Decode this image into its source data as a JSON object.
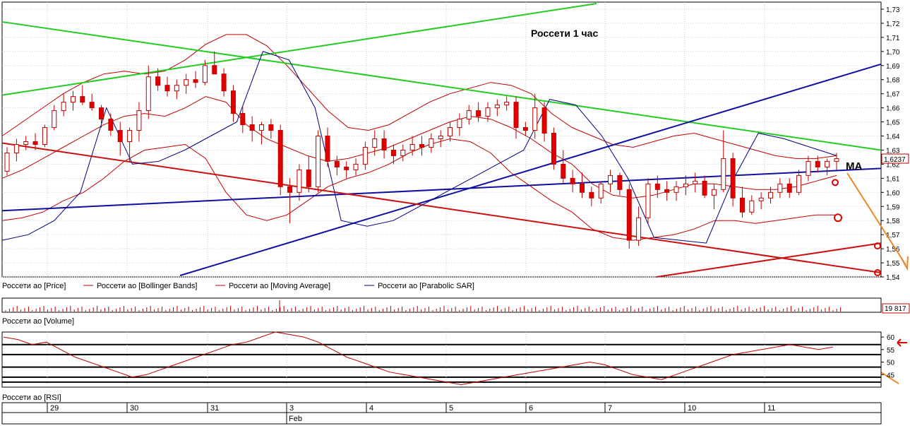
{
  "chart_data": [
    {
      "type": "candlestick",
      "title": "Россети   1 час",
      "annotation": "MA",
      "ylim": [
        1.54,
        1.735
      ],
      "y_ticks": [
        "1,73",
        "1,72",
        "1,71",
        "1,70",
        "1,69",
        "1,68",
        "1,67",
        "1,66",
        "1,65",
        "1,64",
        "1,63",
        "1,62",
        "1,61",
        "1,60",
        "1,59",
        "1,58",
        "1,57",
        "1,56",
        "1,55",
        "1,54"
      ],
      "last_price": "1,6237",
      "legend": [
        {
          "label": "Россети ао [Price]",
          "color": "#000000"
        },
        {
          "label": "Россети ао [Bollinger Bands]",
          "color": "#c00000"
        },
        {
          "label": "Россети ао [Moving Average]",
          "color": "#c00000"
        },
        {
          "label": "Россети ао [Parabolic SAR]",
          "color": "#000080"
        }
      ],
      "candles": [
        [
          1.615,
          1.632,
          1.612,
          1.628
        ],
        [
          1.628,
          1.638,
          1.622,
          1.634
        ],
        [
          1.634,
          1.64,
          1.63,
          1.636
        ],
        [
          1.636,
          1.642,
          1.63,
          1.634
        ],
        [
          1.634,
          1.648,
          1.632,
          1.646
        ],
        [
          1.646,
          1.662,
          1.644,
          1.658
        ],
        [
          1.658,
          1.67,
          1.654,
          1.664
        ],
        [
          1.664,
          1.672,
          1.658,
          1.668
        ],
        [
          1.668,
          1.676,
          1.662,
          1.664
        ],
        [
          1.664,
          1.67,
          1.658,
          1.66
        ],
        [
          1.66,
          1.662,
          1.646,
          1.652
        ],
        [
          1.652,
          1.656,
          1.64,
          1.644
        ],
        [
          1.644,
          1.65,
          1.626,
          1.636
        ],
        [
          1.636,
          1.646,
          1.622,
          1.644
        ],
        [
          1.644,
          1.664,
          1.636,
          1.658
        ],
        [
          1.658,
          1.69,
          1.652,
          1.682
        ],
        [
          1.682,
          1.688,
          1.672,
          1.676
        ],
        [
          1.676,
          1.682,
          1.668,
          1.672
        ],
        [
          1.672,
          1.68,
          1.666,
          1.676
        ],
        [
          1.676,
          1.684,
          1.67,
          1.68
        ],
        [
          1.68,
          1.686,
          1.674,
          1.678
        ],
        [
          1.678,
          1.694,
          1.676,
          1.69
        ],
        [
          1.69,
          1.7,
          1.684,
          1.684
        ],
        [
          1.684,
          1.688,
          1.668,
          1.672
        ],
        [
          1.672,
          1.676,
          1.65,
          1.656
        ],
        [
          1.656,
          1.662,
          1.642,
          1.648
        ],
        [
          1.648,
          1.654,
          1.636,
          1.644
        ],
        [
          1.644,
          1.65,
          1.634,
          1.648
        ],
        [
          1.648,
          1.652,
          1.638,
          1.644
        ],
        [
          1.644,
          1.648,
          1.598,
          1.604
        ],
        [
          1.604,
          1.61,
          1.578,
          1.6
        ],
        [
          1.6,
          1.62,
          1.594,
          1.616
        ],
        [
          1.616,
          1.626,
          1.6,
          1.604
        ],
        [
          1.604,
          1.644,
          1.6,
          1.64
        ],
        [
          1.64,
          1.646,
          1.618,
          1.622
        ],
        [
          1.622,
          1.626,
          1.612,
          1.618
        ],
        [
          1.618,
          1.622,
          1.61,
          1.616
        ],
        [
          1.616,
          1.624,
          1.612,
          1.62
        ],
        [
          1.62,
          1.636,
          1.616,
          1.632
        ],
        [
          1.632,
          1.644,
          1.626,
          1.638
        ],
        [
          1.638,
          1.644,
          1.624,
          1.63
        ],
        [
          1.63,
          1.634,
          1.62,
          1.626
        ],
        [
          1.626,
          1.634,
          1.622,
          1.63
        ],
        [
          1.63,
          1.64,
          1.626,
          1.634
        ],
        [
          1.634,
          1.64,
          1.626,
          1.632
        ],
        [
          1.632,
          1.642,
          1.628,
          1.638
        ],
        [
          1.638,
          1.644,
          1.632,
          1.64
        ],
        [
          1.64,
          1.65,
          1.636,
          1.646
        ],
        [
          1.646,
          1.656,
          1.64,
          1.652
        ],
        [
          1.652,
          1.662,
          1.648,
          1.658
        ],
        [
          1.658,
          1.664,
          1.65,
          1.654
        ],
        [
          1.654,
          1.664,
          1.65,
          1.66
        ],
        [
          1.66,
          1.666,
          1.654,
          1.662
        ],
        [
          1.662,
          1.668,
          1.658,
          1.664
        ],
        [
          1.664,
          1.668,
          1.638,
          1.646
        ],
        [
          1.646,
          1.65,
          1.64,
          1.644
        ],
        [
          1.644,
          1.67,
          1.638,
          1.66
        ],
        [
          1.66,
          1.664,
          1.636,
          1.642
        ],
        [
          1.642,
          1.646,
          1.616,
          1.62
        ],
        [
          1.62,
          1.63,
          1.606,
          1.61
        ],
        [
          1.61,
          1.616,
          1.6,
          1.606
        ],
        [
          1.606,
          1.614,
          1.596,
          1.6
        ],
        [
          1.6,
          1.604,
          1.59,
          1.596
        ],
        [
          1.596,
          1.608,
          1.592,
          1.606
        ],
        [
          1.606,
          1.616,
          1.6,
          1.612
        ],
        [
          1.612,
          1.614,
          1.598,
          1.602
        ],
        [
          1.602,
          1.606,
          1.56,
          1.566
        ],
        [
          1.566,
          1.59,
          1.562,
          1.582
        ],
        [
          1.582,
          1.61,
          1.578,
          1.606
        ],
        [
          1.606,
          1.612,
          1.596,
          1.602
        ],
        [
          1.602,
          1.608,
          1.594,
          1.6
        ],
        [
          1.6,
          1.608,
          1.594,
          1.604
        ],
        [
          1.604,
          1.612,
          1.598,
          1.606
        ],
        [
          1.606,
          1.614,
          1.6,
          1.608
        ],
        [
          1.608,
          1.612,
          1.596,
          1.598
        ],
        [
          1.598,
          1.606,
          1.588,
          1.602
        ],
        [
          1.602,
          1.644,
          1.6,
          1.624
        ],
        [
          1.624,
          1.628,
          1.59,
          1.596
        ],
        [
          1.596,
          1.604,
          1.582,
          1.586
        ],
        [
          1.586,
          1.598,
          1.584,
          1.594
        ],
        [
          1.594,
          1.6,
          1.588,
          1.596
        ],
        [
          1.596,
          1.604,
          1.592,
          1.6
        ],
        [
          1.6,
          1.61,
          1.596,
          1.606
        ],
        [
          1.606,
          1.61,
          1.596,
          1.6
        ],
        [
          1.6,
          1.616,
          1.598,
          1.612
        ],
        [
          1.612,
          1.626,
          1.608,
          1.622
        ],
        [
          1.622,
          1.626,
          1.614,
          1.618
        ],
        [
          1.618,
          1.624,
          1.612,
          1.622
        ],
        [
          1.622,
          1.628,
          1.616,
          1.624
        ]
      ],
      "bollinger_upper": [
        1.64,
        1.65,
        1.66,
        1.67,
        1.678,
        1.684,
        1.686,
        1.684,
        1.686,
        1.694,
        1.705,
        1.712,
        1.712,
        1.704,
        1.69,
        1.674,
        1.658,
        1.646,
        1.644,
        1.648,
        1.656,
        1.664,
        1.67,
        1.674,
        1.678,
        1.676,
        1.67,
        1.656,
        1.646,
        1.64,
        1.634,
        1.632,
        1.636,
        1.64,
        1.642,
        1.638,
        1.634,
        1.63,
        1.626,
        1.624,
        1.624,
        1.626
      ],
      "bollinger_lower": [
        1.58,
        1.582,
        1.586,
        1.594,
        1.6,
        1.61,
        1.622,
        1.63,
        1.632,
        1.634,
        1.624,
        1.6,
        1.584,
        1.58,
        1.584,
        1.594,
        1.604,
        1.61,
        1.614,
        1.62,
        1.628,
        1.634,
        1.638,
        1.636,
        1.628,
        1.614,
        1.604,
        1.594,
        1.586,
        1.574,
        1.568,
        1.566,
        1.568,
        1.57,
        1.574,
        1.58,
        1.58,
        1.578,
        1.58,
        1.582,
        1.584,
        1.584
      ],
      "moving_average": [
        1.61,
        1.616,
        1.624,
        1.632,
        1.64,
        1.648,
        1.654,
        1.656,
        1.654,
        1.66,
        1.668,
        1.664,
        1.648,
        1.638,
        1.632,
        1.626,
        1.622,
        1.624,
        1.628,
        1.632,
        1.638,
        1.644,
        1.65,
        1.654,
        1.652,
        1.646,
        1.638,
        1.628,
        1.62,
        1.606,
        1.598,
        1.596,
        1.598,
        1.602,
        1.606,
        1.606,
        1.604,
        1.602,
        1.602,
        1.604,
        1.608,
        1.612
      ],
      "parabolic_sar": [
        1.566,
        1.57,
        1.58,
        1.6,
        1.66,
        1.62,
        1.622,
        1.63,
        1.64,
        1.65,
        1.7,
        1.694,
        1.66,
        1.58,
        1.576,
        1.58,
        1.59,
        1.6,
        1.61,
        1.62,
        1.63,
        1.666,
        1.662,
        1.64,
        1.61,
        1.568,
        1.566,
        1.564,
        1.608,
        1.642,
        1.638,
        1.632,
        1.626
      ]
    },
    {
      "type": "bar",
      "title": "Россети ао [Volume]",
      "last_value": "19 817"
    },
    {
      "type": "line",
      "title": "Россети ао [RSI]",
      "y_ticks": [
        "60",
        "55",
        "50",
        "45"
      ],
      "ylim": [
        40,
        62
      ],
      "values": [
        60,
        59,
        57,
        58,
        55,
        52,
        50,
        48,
        46,
        44,
        45,
        47,
        49,
        51,
        53,
        55,
        57,
        58,
        60,
        62,
        61,
        60,
        58,
        55,
        52,
        50,
        48,
        46,
        45,
        44,
        43,
        42,
        41,
        42,
        43,
        44,
        45,
        46,
        47,
        48,
        49,
        50,
        49,
        47,
        45,
        44,
        43,
        45,
        47,
        49,
        51,
        53,
        54,
        55,
        56,
        57,
        56,
        55,
        56
      ]
    },
    {
      "type": "axis",
      "x_ticks": [
        "29",
        "30",
        "31",
        "3",
        "4",
        "5",
        "6",
        "7",
        "10",
        "11"
      ],
      "month_label": "Feb"
    }
  ]
}
